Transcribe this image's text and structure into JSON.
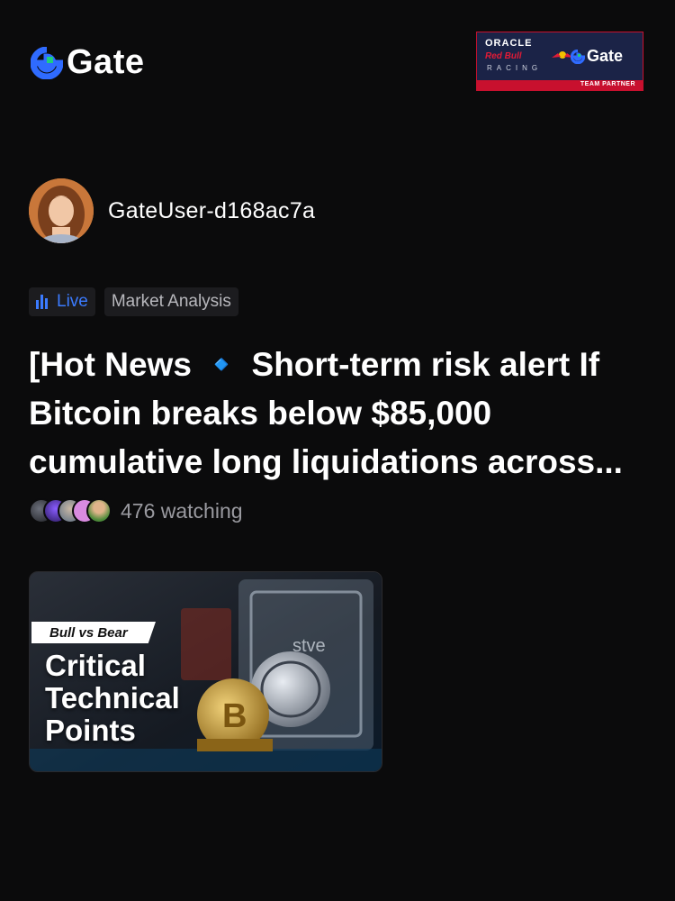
{
  "brand": {
    "name": "Gate",
    "logo_icon": "gate-logo-icon",
    "accent": "#2f6bff"
  },
  "partner": {
    "oracle": "ORACLE",
    "redbull": "Red Bull",
    "racing": "RACING",
    "gate": "Gate",
    "badge": "TEAM PARTNER",
    "colors": {
      "bg": "#1b2347",
      "red": "#c8102e"
    }
  },
  "post": {
    "author": "GateUser-d168ac7a",
    "tags": {
      "live": "Live",
      "category": "Market Analysis"
    },
    "title_lines": [
      "[Hot News 🔹 Short-term risk alert If",
      "Bitcoin breaks below $85,000",
      "cumulative long liquidations across..."
    ],
    "watching": "476 watching",
    "cover": {
      "tagline": "Bull vs Bear",
      "headline_lines": [
        "Critical",
        "Technical",
        "Points"
      ]
    }
  }
}
